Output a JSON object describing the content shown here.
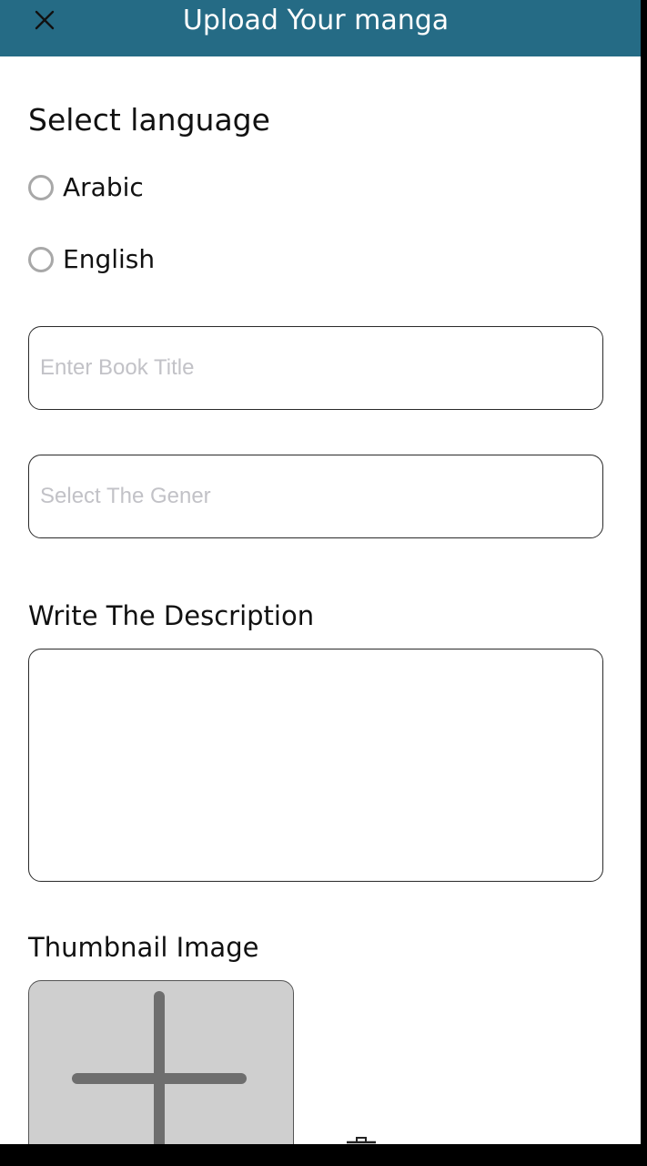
{
  "header": {
    "title": "Upload Your manga",
    "close_icon": "close-icon",
    "background_color": "#256b85"
  },
  "language": {
    "title": "Select language",
    "options": [
      {
        "label": "Arabic",
        "selected": false
      },
      {
        "label": "English",
        "selected": false
      }
    ]
  },
  "form": {
    "book_title_placeholder": "Enter Book Title",
    "book_title_value": "",
    "genre_placeholder": "Select The Gener",
    "genre_value": "",
    "description_title": "Write The Description",
    "description_value": ""
  },
  "thumbnail": {
    "title": "Thumbnail Image",
    "add_icon": "plus-icon",
    "delete_icon": "trash-icon"
  }
}
